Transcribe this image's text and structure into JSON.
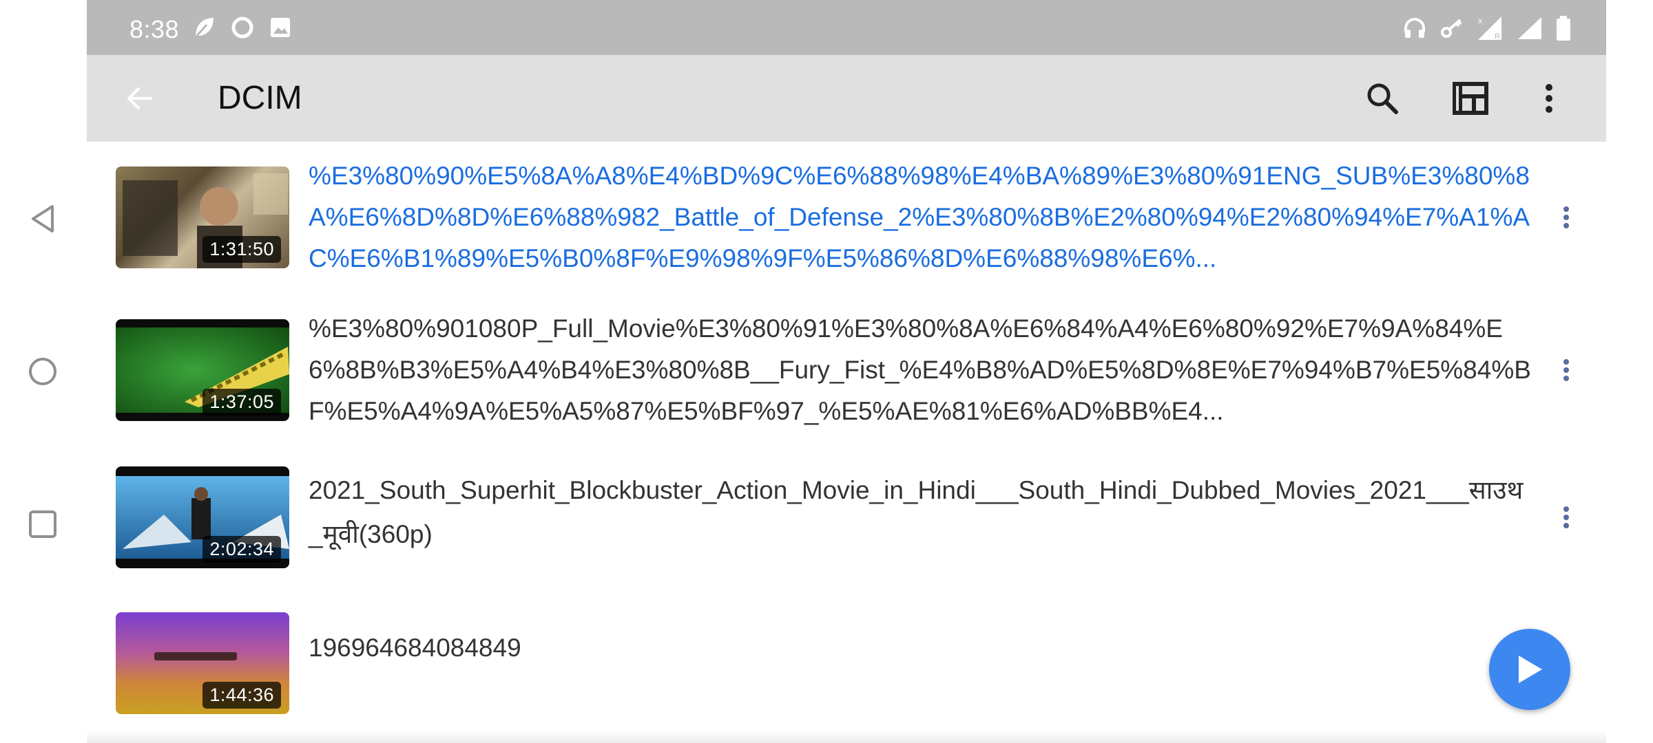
{
  "status_bar": {
    "time": "8:38",
    "left_icons": [
      "leaf-icon",
      "circle-icon",
      "image-icon"
    ],
    "right_icons": [
      "headset-icon",
      "vpn-key-icon",
      "signal-roaming-icon",
      "signal-icon",
      "battery-icon"
    ],
    "background": "#b9b9b9"
  },
  "toolbar": {
    "title": "DCIM",
    "back_icon": "arrow-back-icon",
    "actions": [
      "search-icon",
      "view-layout-icon",
      "more-vert-icon"
    ],
    "background": "#e0e0e0"
  },
  "videos": [
    {
      "title": "%E3%80%90%E5%8A%A8%E4%BD%9C%E6%88%98%E4%BA%89%E3%80%91ENG_SUB%E3%80%8A%E6%8D%8D%E6%88%982_Battle_of_Defense_2%E3%80%8B%E2%80%94%E2%80%94%E7%A1%AC%E6%B1%89%E5%B0%8F%E9%98%9F%E5%86%8D%E6%88%98%E6%...",
      "duration": "1:31:50",
      "playing": true
    },
    {
      "title": "%E3%80%901080P_Full_Movie%E3%80%91%E3%80%8A%E6%84%A4%E6%80%92%E7%9A%84%E6%8B%B3%E5%A4%B4%E3%80%8B__Fury_Fist_%E4%B8%AD%E5%8D%8E%E7%94%B7%E5%84%BF%E5%A4%9A%E5%A5%87%E5%BF%97_%E5%AE%81%E6%AD%BB%E4...",
      "duration": "1:37:05",
      "playing": false
    },
    {
      "title": "2021_South_Superhit_Blockbuster_Action_Movie_in_Hindi___South_Hindi_Dubbed_Movies_2021___साउथ_मूवी(360p)",
      "duration": "2:02:34",
      "playing": false
    },
    {
      "title": "196964684084849",
      "duration": "1:44:36",
      "playing": false
    }
  ],
  "colors": {
    "accent_blue": "#1a6de0",
    "fab": "#3d88f0"
  },
  "fab_icon": "play-icon",
  "system_nav": [
    "nav-back-icon",
    "nav-home-icon",
    "nav-recents-icon"
  ]
}
